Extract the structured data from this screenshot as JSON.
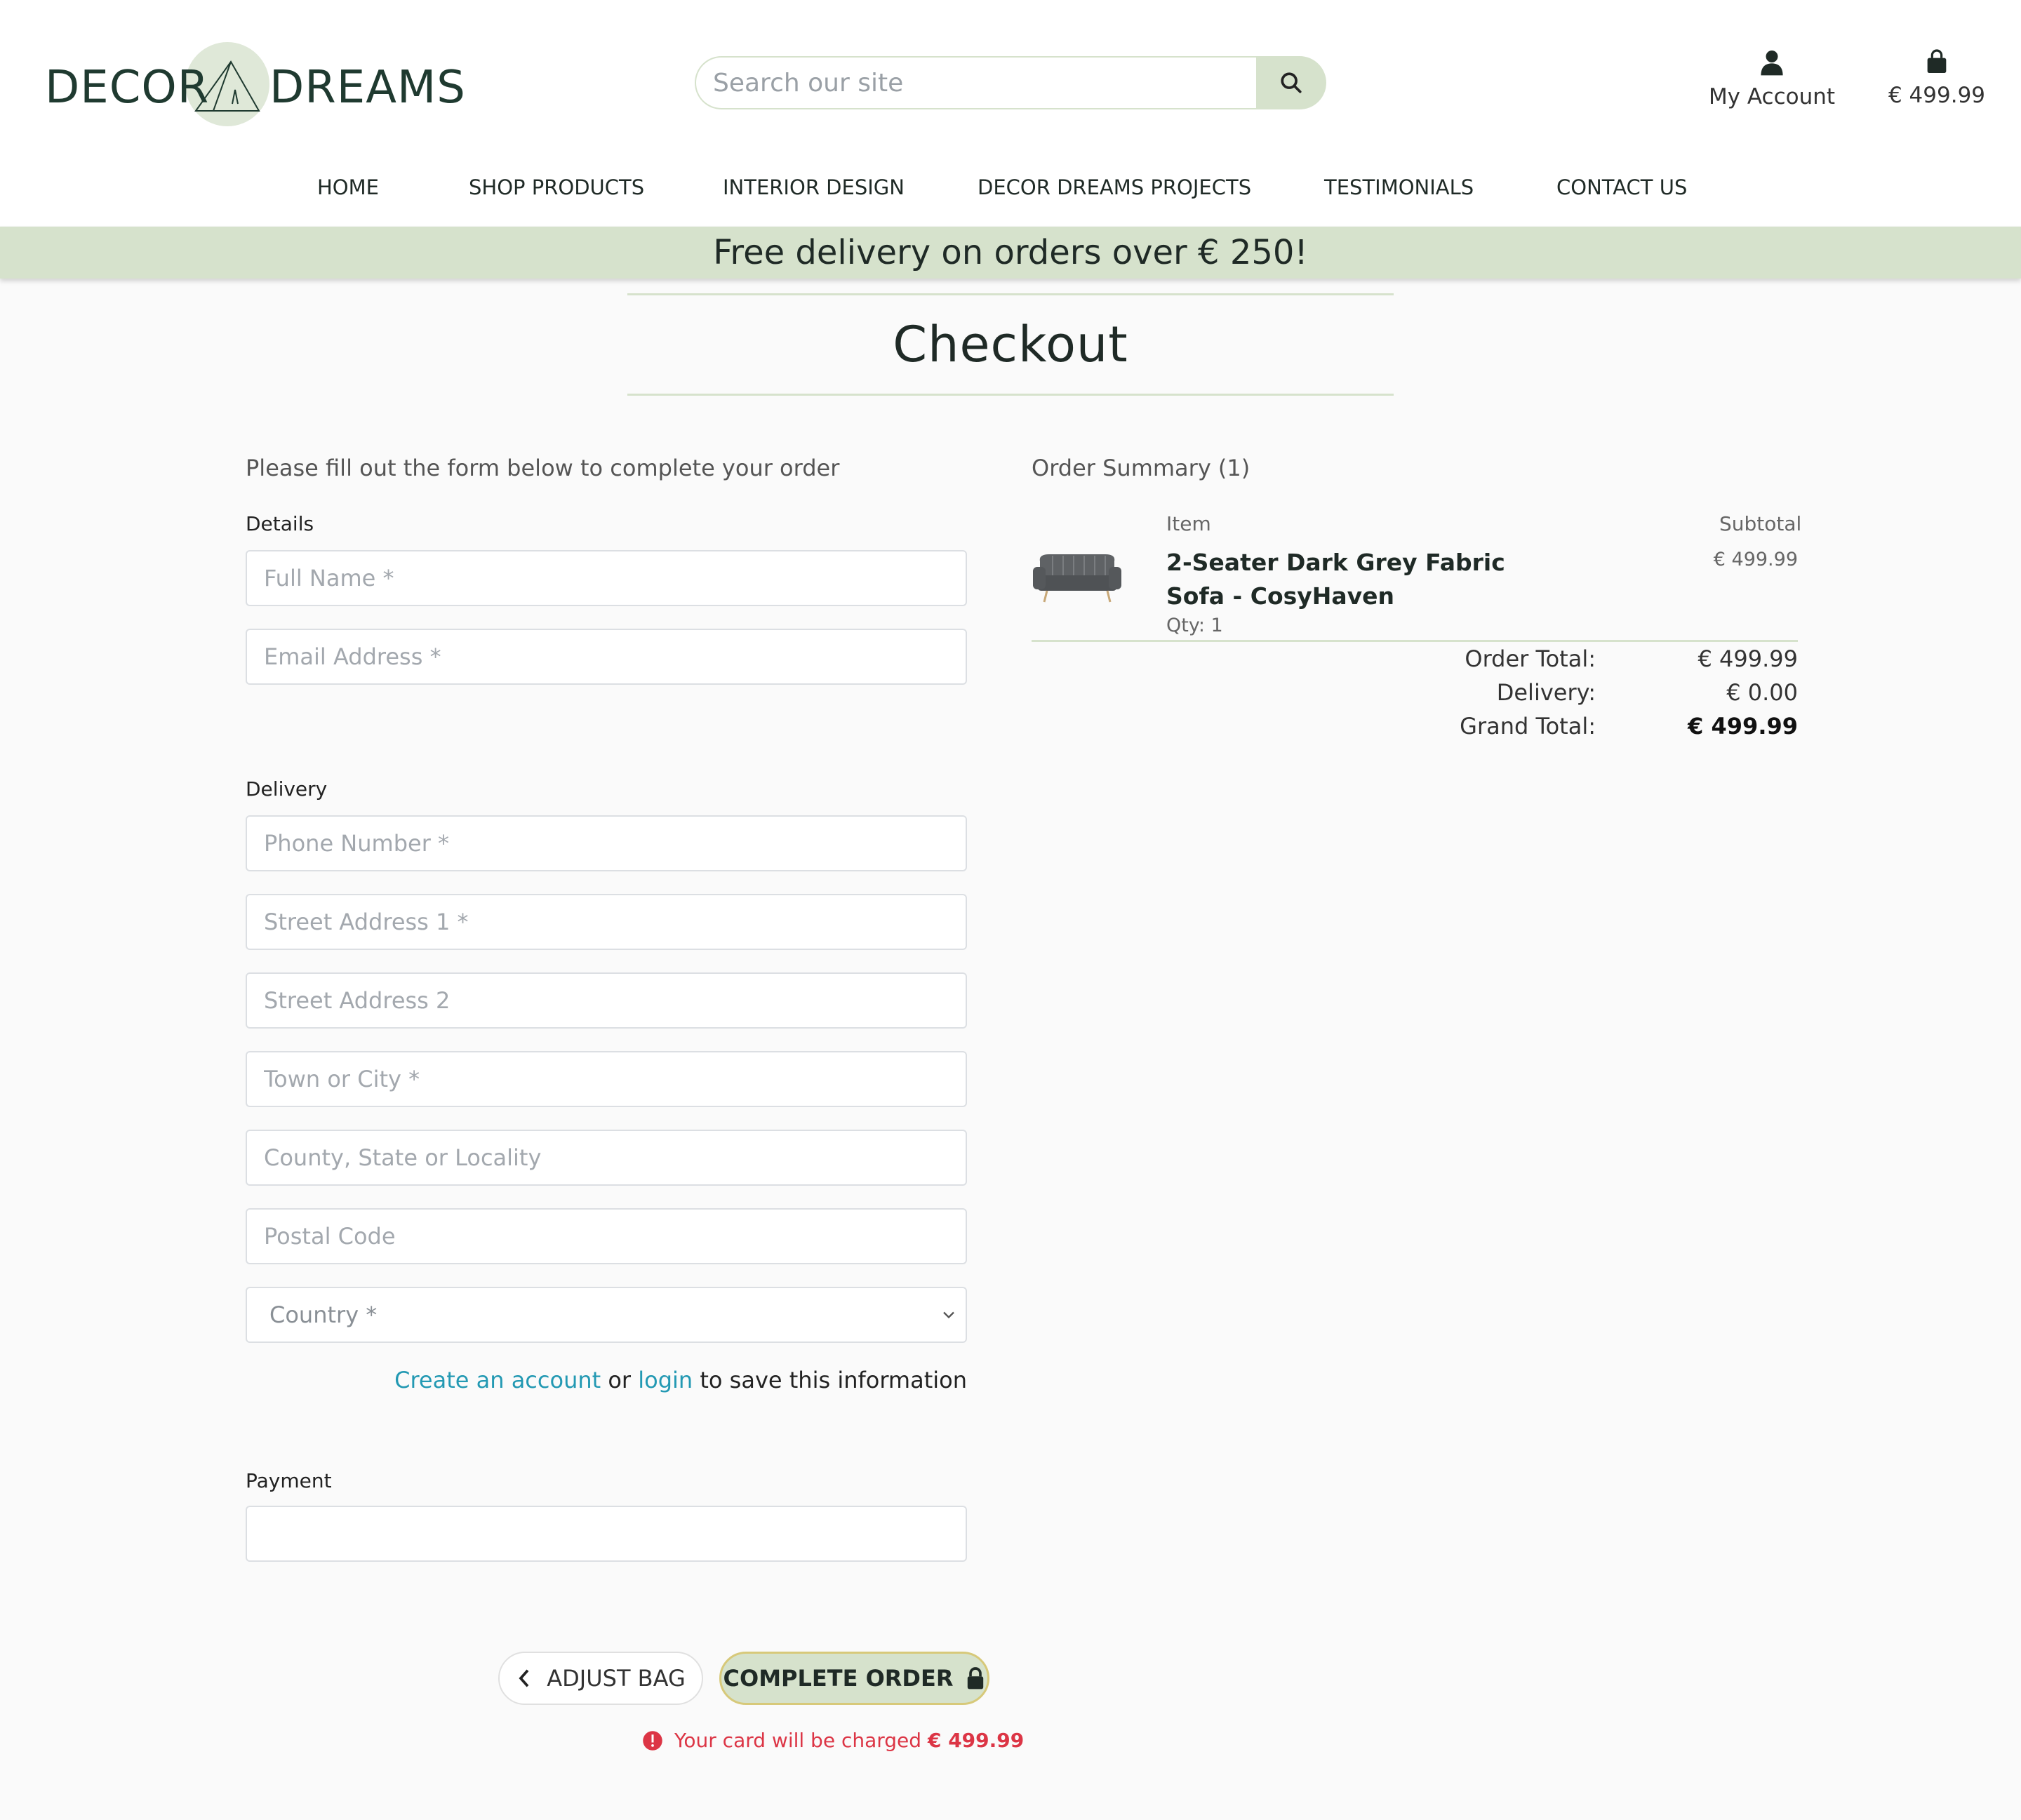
{
  "brand": {
    "left": "DECOR",
    "right": "DREAMS"
  },
  "search": {
    "placeholder": "Search our site"
  },
  "account": {
    "label": "My Account"
  },
  "bag": {
    "total": "€ 499.99"
  },
  "nav": {
    "items": [
      "HOME",
      "SHOP PRODUCTS",
      "INTERIOR DESIGN",
      "DECOR DREAMS PROJECTS",
      "TESTIMONIALS",
      "CONTACT US"
    ]
  },
  "banner": {
    "text": "Free delivery on orders over € 250!"
  },
  "page": {
    "title": "Checkout"
  },
  "form": {
    "intro": "Please fill out the form below to complete your order",
    "details_label": "Details",
    "full_name_placeholder": "Full Name *",
    "email_placeholder": "Email Address *",
    "delivery_label": "Delivery",
    "phone_placeholder": "Phone Number *",
    "street1_placeholder": "Street Address 1 *",
    "street2_placeholder": "Street Address 2",
    "town_placeholder": "Town or City *",
    "county_placeholder": "County, State or Locality",
    "postal_placeholder": "Postal Code",
    "country_placeholder": "Country *",
    "create_account_link": "Create an account",
    "or_text": "or",
    "login_link": "login",
    "save_text": "to save this information",
    "payment_label": "Payment"
  },
  "actions": {
    "adjust_bag": "ADJUST BAG",
    "complete_order": "COMPLETE ORDER",
    "charge_text": "Your card will be charged",
    "charge_amount": "€ 499.99"
  },
  "summary": {
    "title": "Order Summary (1)",
    "col_item": "Item",
    "col_subtotal": "Subtotal",
    "item_name": "2-Seater Dark Grey Fabric Sofa - CosyHaven",
    "item_qty": "Qty: 1",
    "item_price": "€ 499.99",
    "order_total_label": "Order Total:",
    "order_total_value": "€ 499.99",
    "delivery_label": "Delivery:",
    "delivery_value": "€ 0.00",
    "grand_total_label": "Grand Total:",
    "grand_total_value": "€ 499.99"
  }
}
